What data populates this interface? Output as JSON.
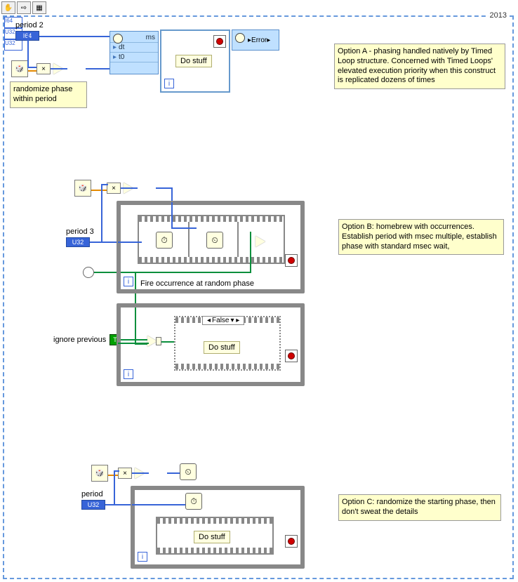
{
  "frame": {
    "year": "2013"
  },
  "toolbar": {
    "hand": "✋",
    "arrow": "⇨",
    "sel": "▦"
  },
  "optionA": {
    "control_name": "period 2",
    "control_type": "I64",
    "randomize_label": "randomize phase within period",
    "timed_loop": {
      "unit": "ms",
      "rows": [
        "dt",
        "t0"
      ],
      "do_stuff": "Do stuff",
      "error_out": "Error"
    },
    "comment": "Option A - phasing handled natively by Timed Loop structure.  Concerned with Timed Loops' elevated execution priority when this construct is replicated dozens of times"
  },
  "optionB": {
    "control_name": "period 3",
    "control_type": "U32",
    "ignore_prev_name": "ignore previous",
    "fire_label": "Fire occurrence at random phase",
    "case_selector": "False",
    "do_stuff": "Do stuff",
    "comment": "Option B: homebrew with occurrences. Establish period with msec multiple, establish phase with standard msec wait,"
  },
  "optionC": {
    "control_name": "period",
    "control_type": "U32",
    "do_stuff": "Do stuff",
    "comment": "Option C: randomize the starting phase, then don't sweat the details"
  },
  "tri_note": "▶"
}
